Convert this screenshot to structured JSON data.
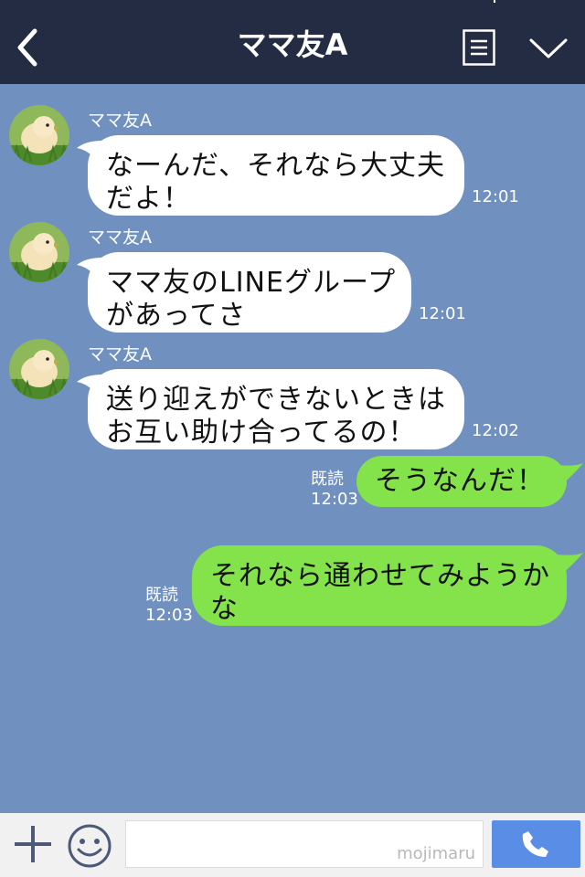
{
  "header": {
    "title": "ママ友A",
    "back_icon": "chevron-left-icon",
    "menu_icon": "menu-list-icon",
    "collapse_icon": "chevron-down-icon"
  },
  "messages": [
    {
      "direction": "in",
      "sender": "ママ友A",
      "lines": [
        "なーんだ、それなら大丈夫",
        "だよ！"
      ],
      "time": "12:01"
    },
    {
      "direction": "in",
      "sender": "ママ友A",
      "lines": [
        "ママ友のLINEグループ",
        "があってさ"
      ],
      "time": "12:01"
    },
    {
      "direction": "in",
      "sender": "ママ友A",
      "lines": [
        "送り迎えができないときは",
        "お互い助け合ってるの！"
      ],
      "time": "12:02"
    },
    {
      "direction": "out",
      "lines": [
        "そうなんだ！"
      ],
      "read": "既読",
      "time": "12:03"
    },
    {
      "direction": "out",
      "lines": [
        "それなら通わせてみようか",
        "な"
      ],
      "read": "既読",
      "time": "12:03"
    }
  ],
  "input_bar": {
    "plus_icon": "plus-icon",
    "emoji_icon": "smiley-icon",
    "input_value": "",
    "watermark": "mojimaru",
    "call_icon": "phone-icon"
  },
  "colors": {
    "header_bg": "#232c42",
    "chat_bg": "#7090c0",
    "incoming_bubble": "#ffffff",
    "outgoing_bubble": "#84e24a",
    "call_button": "#5a8ee6"
  }
}
